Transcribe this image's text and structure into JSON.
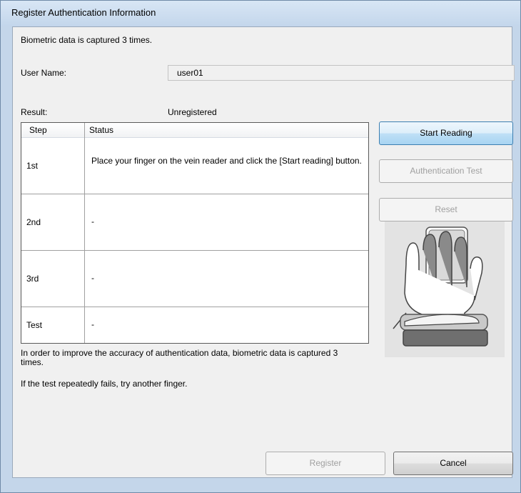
{
  "window": {
    "title": "Register Authentication Information"
  },
  "intro_text": "Biometric data is captured 3 times.",
  "user_name": {
    "label": "User Name:",
    "value": "user01"
  },
  "result": {
    "label": "Result:",
    "value": "Unregistered"
  },
  "table": {
    "headers": [
      "Step",
      "Status"
    ],
    "rows": [
      {
        "step": "1st",
        "status": "Place your finger on the vein reader and click the [Start reading] button."
      },
      {
        "step": "2nd",
        "status": "-"
      },
      {
        "step": "3rd",
        "status": "-"
      },
      {
        "step": "Test",
        "status": "-"
      }
    ]
  },
  "buttons": {
    "start_reading": "Start Reading",
    "authentication_test": "Authentication Test",
    "reset": "Reset",
    "register": "Register",
    "cancel": "Cancel"
  },
  "notes": {
    "accuracy": "In order to improve the accuracy of authentication data, biometric data is captured 3 times.",
    "retry": "If the test repeatedly fails, try another finger."
  },
  "icons": [
    "vein-reader-illustration-icon"
  ],
  "colors": {
    "frame": "#c4d6ea",
    "client_bg": "#f0f0f0",
    "primary_button_border": "#3c7fb1",
    "disabled_text": "#a0a0a0"
  }
}
